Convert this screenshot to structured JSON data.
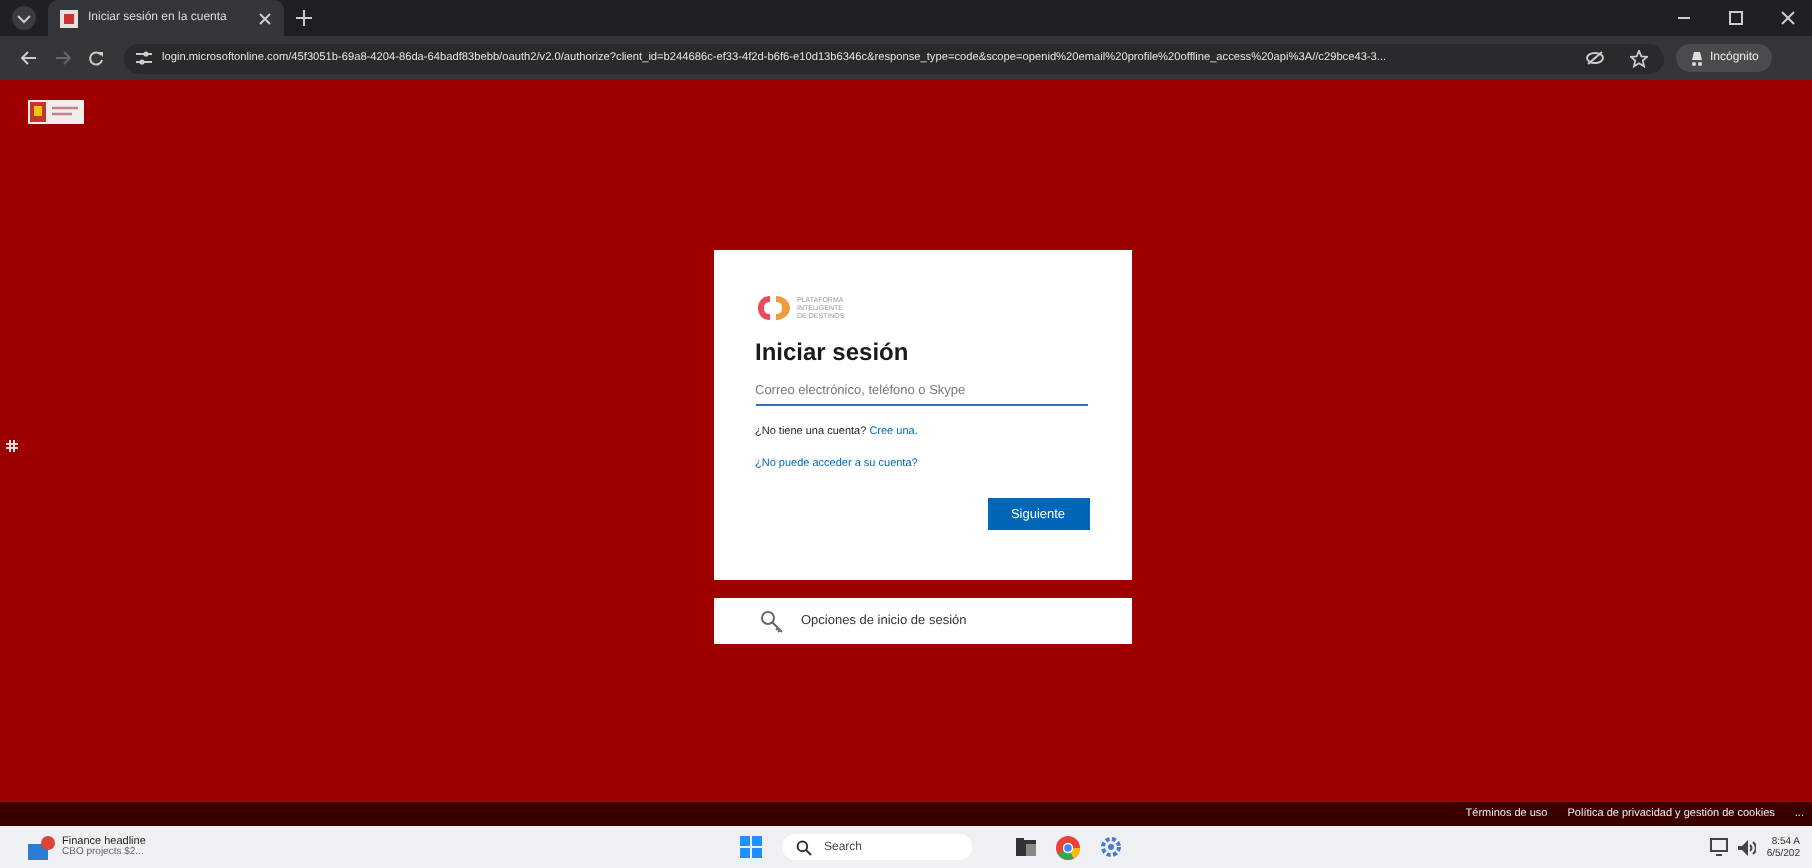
{
  "browser": {
    "tab_title": "Iniciar sesión en la cuenta",
    "url": "login.microsoftonline.com/45f3051b-69a8-4204-86da-64badf83bebb/oauth2/v2.0/authorize?client_id=b244686c-ef33-4f2d-b6f6-e10d13b6346c&response_type=code&scope=openid%20email%20profile%20offline_access%20api%3A//c29bce43-3...",
    "incognito_label": "Incógnito"
  },
  "signin": {
    "logo_text": "PLATAFORMA INTELIGENTE DE DESTINOS",
    "title": "Iniciar sesión",
    "email_placeholder": "Correo electrónico, teléfono o Skype",
    "no_account": "¿No tiene una cuenta?",
    "create_link": "Cree una.",
    "cant_access": "¿No puede acceder a su cuenta?",
    "next_button": "Siguiente",
    "options": "Opciones de inicio de sesión"
  },
  "footer": {
    "links": [
      "Términos de uso",
      "Política de privacidad y gestión de cookies"
    ],
    "more": "..."
  },
  "taskbar": {
    "news_title": "Finance headline",
    "news_sub": "CBO projects $2...",
    "search": "Search",
    "time": "8:54 A",
    "date": "6/5/202"
  }
}
